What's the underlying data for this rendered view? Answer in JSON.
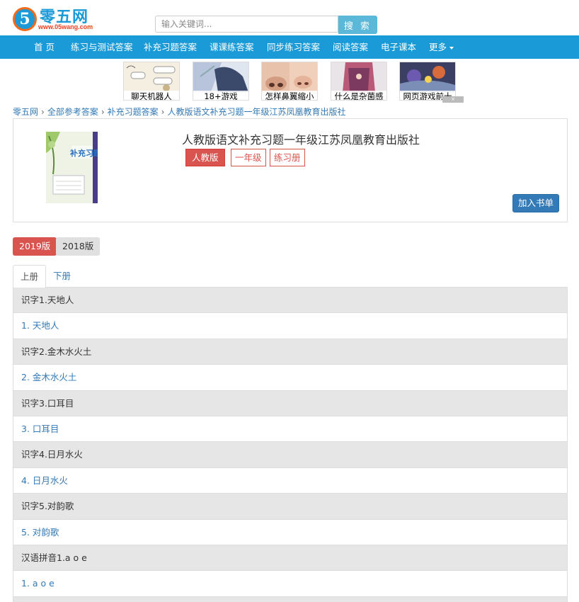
{
  "site": {
    "logo_digit": "5",
    "logo_name": "零五网",
    "logo_url": "www.05wang.com"
  },
  "search": {
    "placeholder": "输入关键词...",
    "button_label": "搜 索"
  },
  "nav": {
    "items": [
      "首 页",
      "练习与测试答案",
      "补充习题答案",
      "课课练答案",
      "同步练习答案",
      "阅读答案",
      "电子课本",
      "更多"
    ]
  },
  "ads": {
    "items": [
      {
        "caption": "聊天机器人"
      },
      {
        "caption": "18+游戏"
      },
      {
        "caption": "怎样鼻翼缩小"
      },
      {
        "caption": "什么是杂菌感"
      },
      {
        "caption": "网页游戏前十"
      }
    ]
  },
  "breadcrumb": {
    "items": [
      "零五网",
      "全部参考答案",
      "补充习题答案",
      "人教版语文补充习题一年级江苏凤凰教育出版社"
    ],
    "separator": "›"
  },
  "book": {
    "title": "人教版语文补充习题一年级江苏凤凰教育出版社",
    "tags": [
      "人教版",
      "一年级",
      "练习册"
    ],
    "add_button": "加入书单",
    "cover_title": "补充习题"
  },
  "editions": [
    "2019版",
    "2018版"
  ],
  "tabs": [
    "上册",
    "下册"
  ],
  "chapters": [
    {
      "type": "heading",
      "text": "识字1.天地人"
    },
    {
      "type": "item",
      "text": "1. 天地人"
    },
    {
      "type": "heading",
      "text": "识字2.金木水火土"
    },
    {
      "type": "item",
      "text": "2. 金木水火土"
    },
    {
      "type": "heading",
      "text": "识字3.口耳目"
    },
    {
      "type": "item",
      "text": "3. 口耳目"
    },
    {
      "type": "heading",
      "text": "识字4.日月水火"
    },
    {
      "type": "item",
      "text": "4. 日月水火"
    },
    {
      "type": "heading",
      "text": "识字5.对韵歌"
    },
    {
      "type": "item",
      "text": "5. 对韵歌"
    },
    {
      "type": "heading",
      "text": "汉语拼音1.a o e"
    },
    {
      "type": "item",
      "text": "1. a o e"
    },
    {
      "type": "heading",
      "text": ""
    }
  ],
  "colors": {
    "brand_blue": "#1a9ad6",
    "tag_red": "#d9534f",
    "link_blue": "#337ab7"
  }
}
